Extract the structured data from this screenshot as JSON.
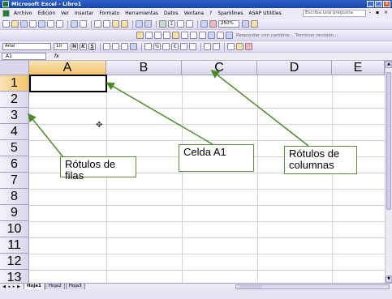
{
  "window": {
    "title": "Microsoft Excel - Libro1",
    "controls": [
      "_",
      "□",
      "×"
    ]
  },
  "menu": {
    "items": [
      "Archivo",
      "Edición",
      "Ver",
      "Insertar",
      "Formato",
      "Herramientas",
      "Datos",
      "Ventana",
      "?",
      "Sparklines",
      "ASAP Utilities"
    ],
    "help_placeholder": "Escriba una pregunta",
    "doc_controls": "- ▪ ×"
  },
  "toolbar": {
    "zoom": "250%",
    "font_name": "Arial",
    "font_size": "10",
    "bold": "N",
    "italic": "K",
    "underline": "S",
    "reply_text": "Responder con cambios...",
    "end_review": "Terminar revisión..."
  },
  "formula_bar": {
    "name_box": "A1",
    "fx": "fx",
    "content": ""
  },
  "grid": {
    "columns": [
      "A",
      "B",
      "C",
      "D",
      "E"
    ],
    "rows": [
      "1",
      "2",
      "3",
      "4",
      "5",
      "6",
      "7",
      "8",
      "9",
      "10",
      "11",
      "12",
      "13"
    ],
    "active_cell": "A1"
  },
  "annotations": {
    "row_labels": "Rótulos de filas",
    "cell_a1": "Celda A1",
    "column_labels_line1": "Rótulos de",
    "column_labels_line2": "columnas",
    "arrow_color": "#4f8a2a"
  },
  "sheets": {
    "tabs": [
      "Hoja1",
      "Hoja2",
      "Hoja3"
    ],
    "active": "Hoja1"
  }
}
